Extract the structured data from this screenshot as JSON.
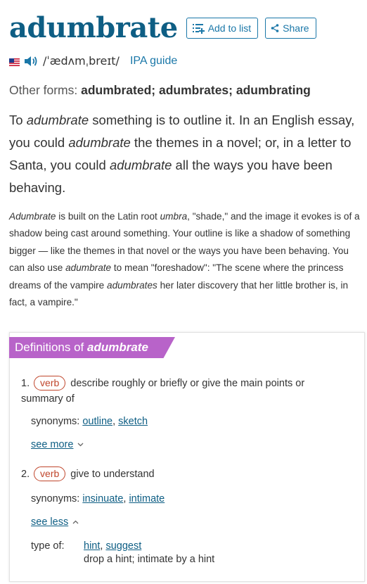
{
  "header": {
    "word": "adumbrate",
    "add_to_list": "Add to list",
    "share": "Share"
  },
  "pronunciation": {
    "flag_icon": "us-flag-icon",
    "audio_icon": "speaker-icon",
    "ipa": "/ˈædʌmˌbreɪt/",
    "ipa_guide": "IPA guide"
  },
  "other_forms": {
    "label": "Other forms:",
    "value": "adumbrated; adumbrates; adumbrating"
  },
  "short_desc": {
    "p1": "To ",
    "p2": "adumbrate",
    "p3": " something is to outline it. In an English essay, you could ",
    "p4": "adumbrate",
    "p5": " the themes in a novel; or, in a letter to Santa, you could ",
    "p6": "adumbrate",
    "p7": " all the ways you have been behaving."
  },
  "long_desc": {
    "p1": "Adumbrate",
    "p2": " is built on the Latin root ",
    "p3": "umbra",
    "p4": ", \"shade,\" and the image it evokes is of a shadow being cast around something. Your outline is like a shadow of something bigger — like the themes in that novel or the ways you have been behaving. You can also use ",
    "p5": "adumbrate",
    "p6": " to mean \"foreshadow\": \"The scene where the princess dreams of the vampire ",
    "p7": "adumbrates",
    "p8": " her later discovery that her little brother is, in fact, a vampire.\""
  },
  "definitions": {
    "tab_prefix": "Definitions of ",
    "tab_word": "adumbrate",
    "items": [
      {
        "num": "1.",
        "pos": "verb",
        "text": "describe roughly or briefly or give the main points or summary of",
        "syn_label": "synonyms:",
        "synonyms": [
          "outline",
          "sketch"
        ],
        "toggle": "see more"
      },
      {
        "num": "2.",
        "pos": "verb",
        "text": "give to understand",
        "syn_label": "synonyms:",
        "synonyms": [
          "insinuate",
          "intimate"
        ],
        "toggle": "see less",
        "type_of_label": "type of:",
        "type_of": [
          "hint",
          "suggest"
        ],
        "type_of_def": "drop a hint; intimate by a hint"
      }
    ]
  },
  "colors": {
    "brand_blue": "#0e5e84",
    "link_blue": "#1a77a8",
    "tab_purple": "#b863c9",
    "pos_red": "#c0462c"
  }
}
